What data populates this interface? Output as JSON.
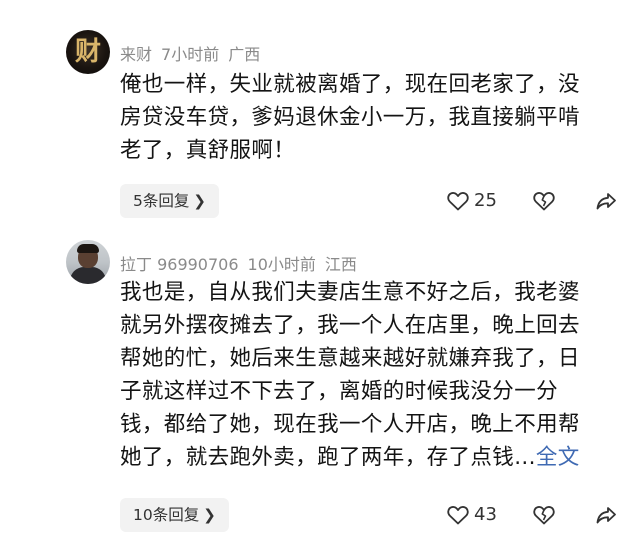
{
  "comments": [
    {
      "username": "来财",
      "time": "7小时前",
      "location": "广西",
      "avatar_glyph": "财",
      "lines": [
        "俺也一样，失业就被离婚了，现在回老家了，没",
        "房贷没车贷，爹妈退休金小一万，我直接躺平啃",
        "老了，真舒服啊！"
      ],
      "replies": "5条回复",
      "likes": "25"
    },
    {
      "username": "拉丁 96990706",
      "time": "10小时前",
      "location": "江西",
      "lines": [
        "我也是，自从我们夫妻店生意不好之后，我老婆",
        "就另外摆夜摊去了，我一个人在店里，晚上回去",
        "帮她的忙，她后来生意越来越好就嫌弃我了，日",
        "子就这样过不下去了，离婚的时候我没分一分",
        "钱，都给了她，现在我一个人开店，晚上不用帮",
        "她了，就去跑外卖，跑了两年，存了点钱..."
      ],
      "more": "全文",
      "replies": "10条回复",
      "likes": "43"
    }
  ]
}
